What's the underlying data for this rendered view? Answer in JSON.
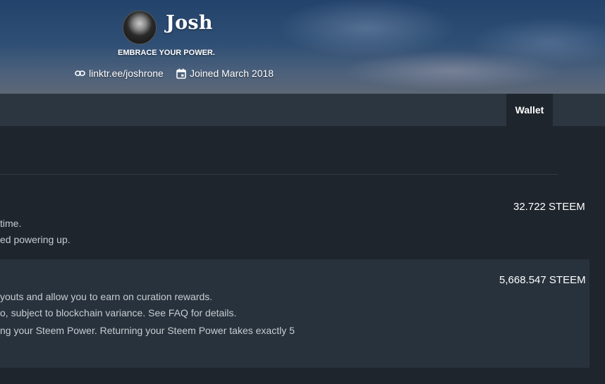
{
  "profile": {
    "name": "Josh",
    "tagline": "EMBRACE YOUR POWER.",
    "link": "linktr.ee/joshrone",
    "joined": "Joined March 2018",
    "link_icon": "link-icon",
    "calendar_icon": "calendar-icon"
  },
  "tabs": {
    "wallet": "Wallet"
  },
  "wallet": {
    "steem": {
      "line1": "time.",
      "line2": "ed powering up.",
      "amount": "32.722 STEEM"
    },
    "steem_power": {
      "line1": "youts and allow you to earn on curation rewards.",
      "line2": "o, subject to blockchain variance. See FAQ for details.",
      "line3": "ng your Steem Power. Returning your Steem Power takes exactly 5",
      "amount": "5,668.547 STEEM"
    }
  },
  "colors": {
    "background": "#1f252d",
    "tabbar": "#2c3640",
    "highlight_row": "#28323c"
  }
}
